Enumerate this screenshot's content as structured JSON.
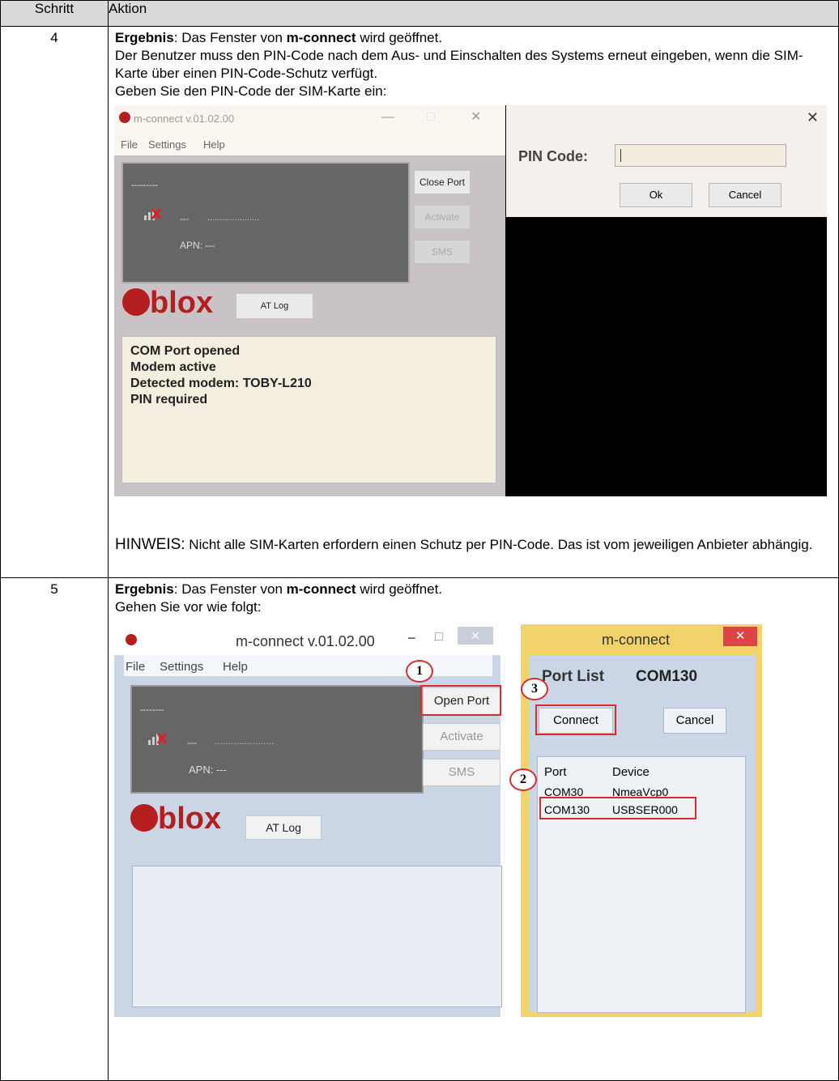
{
  "table": {
    "headers": {
      "step": "Schritt",
      "action": "Aktion"
    },
    "rows": [
      {
        "step": "4",
        "result_label": "Ergebnis",
        "result_mid": ": Das Fenster von ",
        "app": "m-connect",
        "result_end": " wird geöffnet.",
        "line2": "Der Benutzer muss den PIN-Code nach dem Aus- und Einschalten des Systems erneut eingeben, wenn die SIM-Karte über einen PIN-Code-Schutz verfügt.",
        "line3": "Geben Sie den PIN-Code der SIM-Karte ein:",
        "note_label": "HINWEIS:",
        "note_text": " Nicht alle SIM-Karten erfordern einen Schutz per PIN-Code. Das ist vom jeweiligen Anbieter abhängig."
      },
      {
        "step": "5",
        "result_label": "Ergebnis",
        "result_mid": ": Das Fenster von ",
        "app": "m-connect",
        "result_end": " wird geöffnet.",
        "line2": "Gehen Sie vor wie folgt:"
      }
    ]
  },
  "shot1": {
    "title": "m-connect v.01.02.00",
    "ctl_min": "—",
    "ctl_max": "□",
    "ctl_close": "✕",
    "menu": [
      "File",
      "Settings",
      "Help"
    ],
    "panel_dots": "---------",
    "panel_dash": "---",
    "panel_dots2": ".....................",
    "apn": "APN: ---",
    "buttons": {
      "close_port": "Close Port",
      "activate": "Activate",
      "sms": "SMS",
      "at_log": "AT Log"
    },
    "brand": "blox",
    "log_lines": [
      "COM Port opened",
      "Modem active",
      "Detected modem: TOBY-L210",
      "PIN required"
    ],
    "pin_dialog": {
      "close": "✕",
      "label": "PIN Code:",
      "ok": "Ok",
      "cancel": "Cancel"
    }
  },
  "shot2": {
    "title": "m-connect v.01.02.00",
    "ctl_min": "−",
    "ctl_max": "□",
    "ctl_close": "✕",
    "menu": [
      "File",
      "Settings",
      "Help"
    ],
    "panel_dots": "--------",
    "panel_dash": "---",
    "panel_dots2": "......................",
    "apn": "APN: ---",
    "buttons": {
      "open_port": "Open Port",
      "activate": "Activate",
      "sms": "SMS",
      "at_log": "AT Log"
    },
    "brand": "blox",
    "dialog": {
      "title": "m-connect",
      "close": "✕",
      "port_list_label": "Port List",
      "selected_port": "COM130",
      "connect": "Connect",
      "cancel": "Cancel",
      "col_port": "Port",
      "col_device": "Device",
      "rows": [
        {
          "port": "COM30",
          "device": "NmeaVcp0"
        },
        {
          "port": "COM130",
          "device": "USBSER000"
        }
      ]
    },
    "callouts": [
      "1",
      "2",
      "3"
    ]
  }
}
